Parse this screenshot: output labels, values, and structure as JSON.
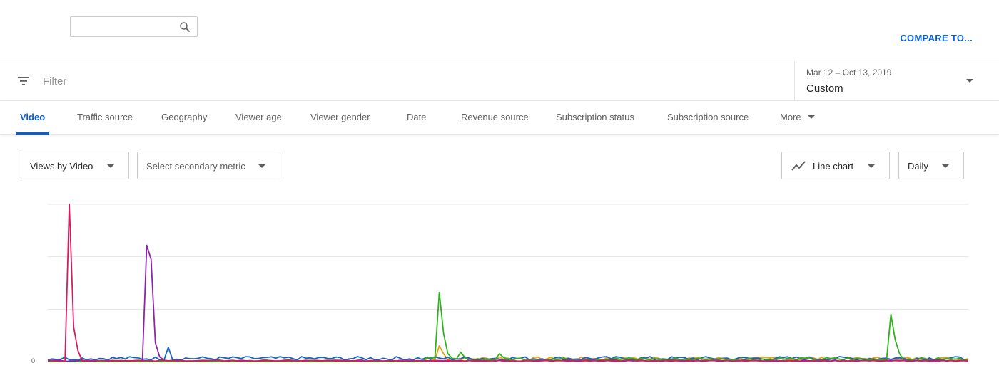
{
  "header": {
    "search": {
      "value": "",
      "placeholder": ""
    },
    "compare_label": "COMPARE TO..."
  },
  "filter": {
    "placeholder": "Filter",
    "date_range": "Mar 12 – Oct 13, 2019",
    "date_preset": "Custom"
  },
  "tabs": [
    {
      "label": "Video",
      "active": true
    },
    {
      "label": "Traffic source"
    },
    {
      "label": "Geography"
    },
    {
      "label": "Viewer age"
    },
    {
      "label": "Viewer gender"
    },
    {
      "label": "Date"
    },
    {
      "label": "Revenue source"
    },
    {
      "label": "Subscription status"
    },
    {
      "label": "Subscription source"
    },
    {
      "label": "More"
    }
  ],
  "controls": {
    "primary_metric": "Views by Video",
    "secondary_metric_placeholder": "Select secondary metric",
    "chart_type": "Line chart",
    "granularity": "Daily"
  },
  "colors": {
    "accent": "#065fd4",
    "series_crimson": "#d81b60",
    "series_purple": "#8e24aa",
    "series_blue": "#1565c0",
    "series_green": "#2fb31c",
    "series_orange": "#f09c10"
  },
  "icons": {
    "search": "search-icon",
    "filter": "filter-icon",
    "chart_type": "line-chart-icon"
  },
  "chart_data": {
    "type": "line",
    "x_start": "2019-03-12",
    "x_end": "2019-10-13",
    "y_tick_labels": [
      "0"
    ],
    "gridlines": 4,
    "grid": true,
    "ylim": [
      0,
      1
    ],
    "series": [
      {
        "color": "#d81b60",
        "spikes": [
          [
            5,
            1.0
          ],
          [
            6,
            0.22
          ],
          [
            7,
            0.07
          ]
        ],
        "base": 0.005
      },
      {
        "color": "#8e24aa",
        "spikes": [
          [
            23,
            0.74
          ],
          [
            24,
            0.65
          ],
          [
            25,
            0.12
          ],
          [
            26,
            0.03
          ]
        ],
        "base": 0.006
      },
      {
        "color": "#1565c0",
        "spikes": [
          [
            28,
            0.09
          ]
        ],
        "base": 0.02
      },
      {
        "color": "#2fb31c",
        "spikes": [
          [
            91,
            0.44
          ],
          [
            92,
            0.18
          ],
          [
            93,
            0.05
          ],
          [
            96,
            0.06
          ],
          [
            105,
            0.05
          ],
          [
            196,
            0.3
          ],
          [
            197,
            0.14
          ],
          [
            198,
            0.05
          ]
        ],
        "base": 0.016,
        "start": 88
      },
      {
        "color": "#f09c10",
        "spikes": [
          [
            91,
            0.1
          ],
          [
            92,
            0.05
          ],
          [
            105,
            0.03
          ]
        ],
        "base": 0.018,
        "start": 88
      }
    ],
    "days": 215
  }
}
